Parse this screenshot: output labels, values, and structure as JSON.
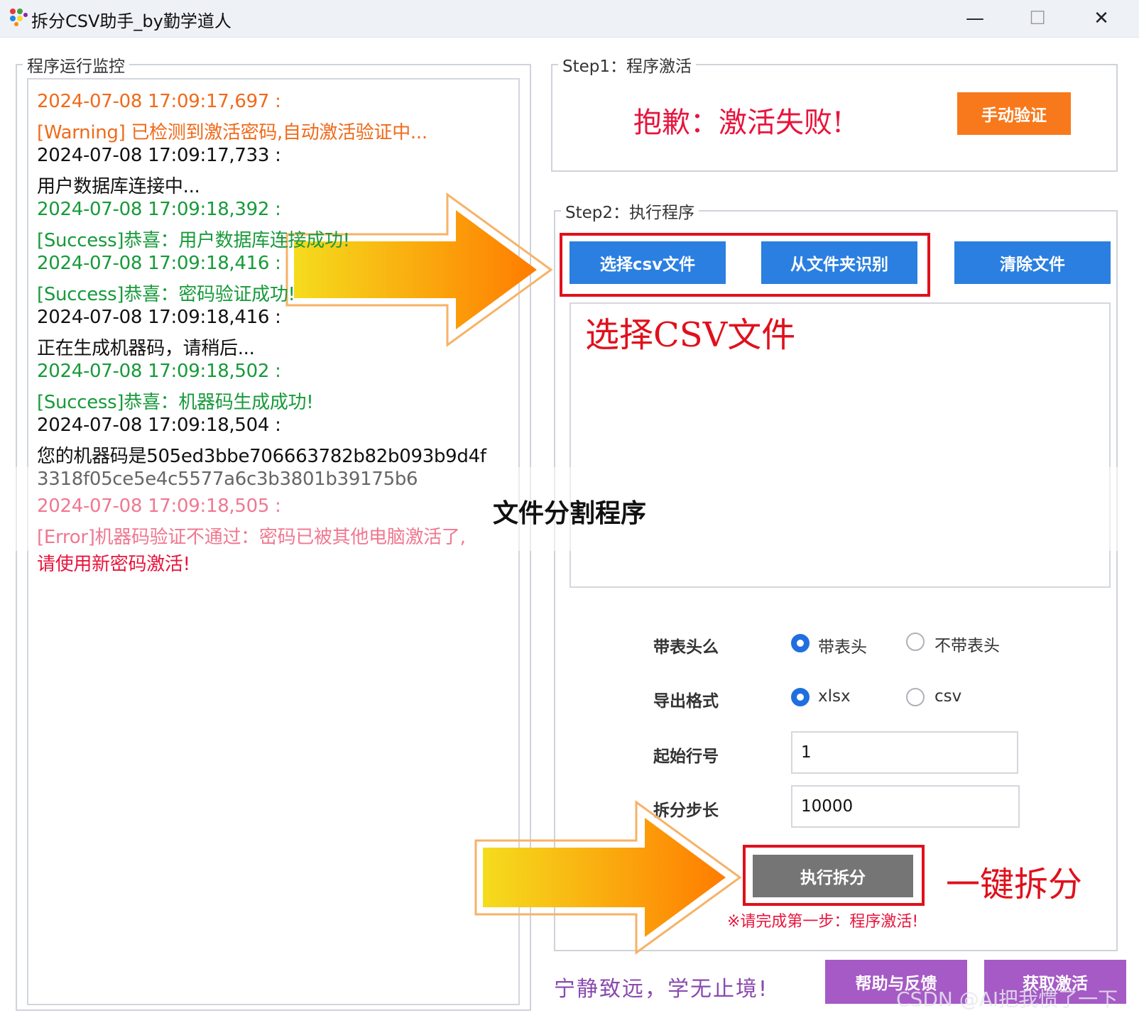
{
  "window": {
    "title": "拆分CSV助手_by勤学道人",
    "minimize_glyph": "—",
    "maximize_glyph": "☐",
    "close_glyph": "✕"
  },
  "log_panel": {
    "title": "程序运行监控",
    "lines": [
      {
        "text": "2024-07-08 17:09:17,697 :",
        "color": "orange"
      },
      {
        "text": "  [Warning] 已检测到激活密码,自动激活验证中...",
        "color": "orange"
      },
      {
        "text": "2024-07-08 17:09:17,733 :",
        "color": "black"
      },
      {
        "text": "  用户数据库连接中...",
        "color": "black"
      },
      {
        "text": "2024-07-08 17:09:18,392 :",
        "color": "green"
      },
      {
        "text": "  [Success]恭喜：用户数据库连接成功!",
        "color": "green"
      },
      {
        "text": "2024-07-08 17:09:18,416 :",
        "color": "green"
      },
      {
        "text": "  [Success]恭喜：密码验证成功!",
        "color": "green"
      },
      {
        "text": "2024-07-08 17:09:18,416 :",
        "color": "black"
      },
      {
        "text": "  正在生成机器码，请稍后...",
        "color": "black"
      },
      {
        "text": "2024-07-08 17:09:18,502 :",
        "color": "green"
      },
      {
        "text": "  [Success]恭喜：机器码生成成功!",
        "color": "green"
      },
      {
        "text": "2024-07-08 17:09:18,504 :",
        "color": "black"
      },
      {
        "text": "  您的机器码是505ed3bbe706663782b82b093b9d4f",
        "color": "black"
      },
      {
        "text": "3318f05ce5e4c5577a6c3b3801b39175b6",
        "color": "gray"
      },
      {
        "text": "2024-07-08 17:09:18,505 :",
        "color": "pink"
      },
      {
        "text": "  [Error]机器码验证不通过：密码已被其他电脑激活了,",
        "color": "pink"
      },
      {
        "text": "请使用新密码激活!",
        "color": "red"
      }
    ]
  },
  "step1": {
    "title": "Step1：程序激活",
    "status": "抱歉：激活失败!",
    "manual_verify_label": "手动验证"
  },
  "step2": {
    "title": "Step2：执行程序",
    "select_csv_label": "选择csv文件",
    "from_folder_label": "从文件夹识别",
    "clear_files_label": "清除文件",
    "file_list_annotation": "选择CSV文件",
    "header_label": "带表头么",
    "header_options": [
      "带表头",
      "不带表头"
    ],
    "header_selected": "带表头",
    "format_label": "导出格式",
    "format_options": [
      "xlsx",
      "csv"
    ],
    "format_selected": "xlsx",
    "start_row_label": "起始行号",
    "start_row_value": "1",
    "split_step_label": "拆分步长",
    "split_step_value": "10000",
    "execute_label": "执行拆分",
    "execute_annotation": "一键拆分",
    "warning": "※请完成第一步：程序激活!"
  },
  "footer": {
    "slogan": "宁静致远，学无止境!",
    "help_label": "帮助与反馈",
    "activate_label": "获取激活",
    "watermark": "CSDN @AI把我惯了一下"
  },
  "overlay": {
    "banner_text": "文件分割程序"
  },
  "colors": {
    "blue_button": "#2b7fe0",
    "orange_button": "#f7791c",
    "gray_button": "#757575",
    "purple_button": "#a55ac5",
    "annotation_red": "#e0101c",
    "status_red": "#e8143c"
  }
}
